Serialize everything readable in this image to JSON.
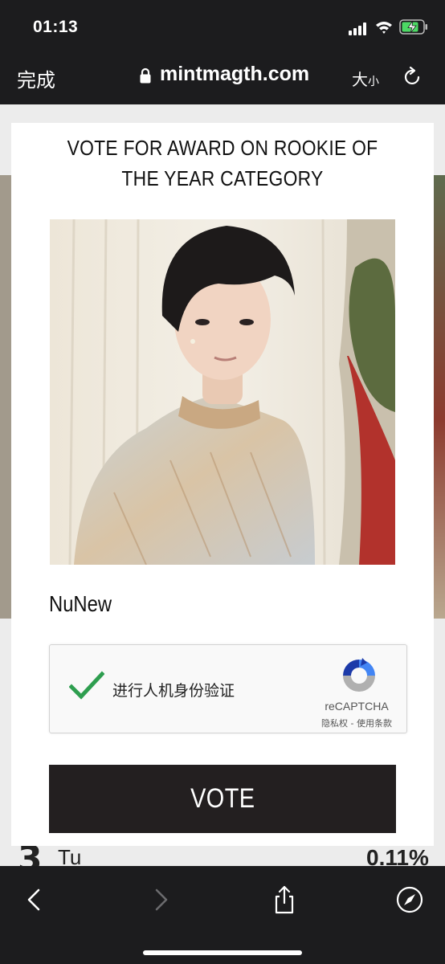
{
  "status_bar": {
    "time": "01:13"
  },
  "browser": {
    "done_label": "完成",
    "domain": "mintmagth.com",
    "text_size_big": "大",
    "text_size_small": "小"
  },
  "background_page": {
    "rank": "3",
    "name": "Tu",
    "percent": "0.11%"
  },
  "modal": {
    "title": "VOTE FOR AWARD ON ROOKIE OF THE YEAR CATEGORY",
    "candidate_name": "NuNew",
    "recaptcha": {
      "label": "进行人机身份验证",
      "brand": "reCAPTCHA",
      "terms": "隐私权 - 使用条款",
      "checked": true
    },
    "vote_label": "VOTE"
  },
  "icons": [
    "lock-icon",
    "reload-icon",
    "check-icon",
    "recaptcha-logo-icon",
    "back-icon",
    "forward-icon",
    "share-icon",
    "compass-icon"
  ],
  "colors": {
    "chrome_bg": "#1c1c1e",
    "vote_button": "#231f20",
    "check_green": "#2e9e4f"
  }
}
